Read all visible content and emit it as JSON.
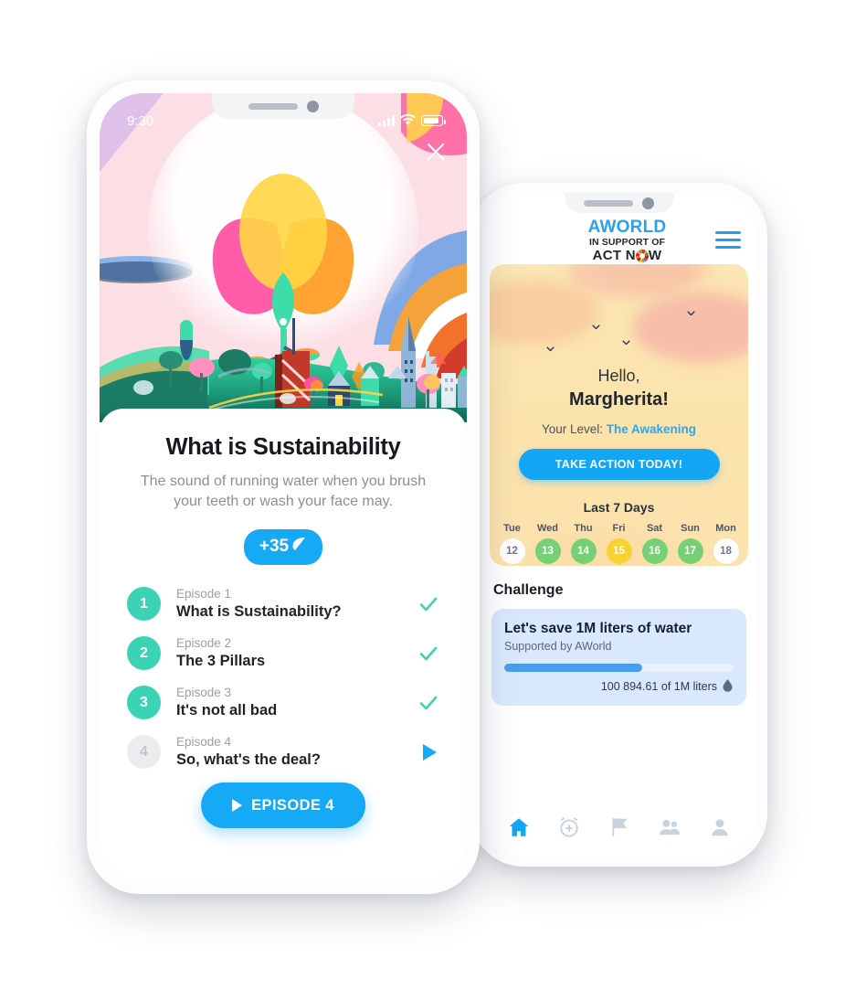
{
  "colors": {
    "accent_blue": "#16a9f6",
    "teal": "#3ad4b4",
    "green_day": "#76d076",
    "yellow_day": "#f8d32f",
    "challenge_card": "#d9e9fb",
    "sky_cream": "#fbe3ab",
    "hero_pink": "#fbe1e6"
  },
  "left_phone": {
    "status_bar": {
      "time": "9:30",
      "icons": [
        "signal-bars-icon",
        "wifi-icon",
        "battery-icon"
      ]
    },
    "close_icon": "close-icon",
    "hero": {
      "illustration": "sustainability-flower-city-illustration"
    },
    "card": {
      "title": "What is Sustainability",
      "description": "The sound of running water when you brush your teeth or wash your face may.",
      "points_badge": "+35",
      "points_icon": "leaf-icon"
    },
    "episodes": [
      {
        "num": "1",
        "label": "Episode 1",
        "title": "What is Sustainability?",
        "state": "done",
        "mark": "check-icon"
      },
      {
        "num": "2",
        "label": "Episode 2",
        "title": "The 3 Pillars",
        "state": "done",
        "mark": "check-icon"
      },
      {
        "num": "3",
        "label": "Episode 3",
        "title": "It's not all bad",
        "state": "done",
        "mark": "check-icon"
      },
      {
        "num": "4",
        "label": "Episode 4",
        "title": "So, what's the deal?",
        "state": "locked",
        "mark": "play-icon"
      }
    ],
    "fab": {
      "label": "EPISODE 4",
      "icon": "play-icon"
    }
  },
  "right_phone": {
    "logo": {
      "line1": "AWORLD",
      "line2": "IN SUPPORT OF",
      "line3a": "ACT N",
      "line3b": "W",
      "wheel_icon": "sdg-wheel-icon"
    },
    "menu_icon": "hamburger-menu-icon",
    "greeting": {
      "hello": "Hello,",
      "name": "Margherita!",
      "level_prefix": "Your Level: ",
      "level_value": "The Awakening",
      "cta": "TAKE ACTION TODAY!"
    },
    "week": {
      "title": "Last 7 Days",
      "days": [
        {
          "name": "Tue",
          "date": "12",
          "state": "none"
        },
        {
          "name": "Wed",
          "date": "13",
          "state": "full"
        },
        {
          "name": "Thu",
          "date": "14",
          "state": "full"
        },
        {
          "name": "Fri",
          "date": "15",
          "state": "part"
        },
        {
          "name": "Sat",
          "date": "16",
          "state": "full"
        },
        {
          "name": "Sun",
          "date": "17",
          "state": "full"
        },
        {
          "name": "Mon",
          "date": "18",
          "state": "none"
        }
      ]
    },
    "challenge": {
      "section_title": "Challenge",
      "title": "Let's save 1M liters of water",
      "subtitle": "Supported by AWorld",
      "progress_text": "100 894.61 of 1M liters",
      "progress_percent": 60,
      "drop_icon": "water-drop-icon"
    },
    "tabs": [
      {
        "icon": "home-icon",
        "active": true
      },
      {
        "icon": "alarm-plus-icon",
        "active": false
      },
      {
        "icon": "flag-icon",
        "active": false
      },
      {
        "icon": "group-icon",
        "active": false
      },
      {
        "icon": "person-icon",
        "active": false
      }
    ]
  }
}
